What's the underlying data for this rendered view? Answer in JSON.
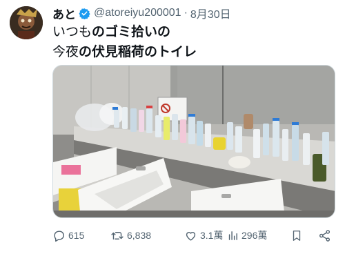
{
  "tweet": {
    "display_name": "あと",
    "handle": "@atoreiyu200001",
    "separator": "·",
    "date": "8月30日",
    "text_line1_light": "いつも",
    "text_line1_bold": "のゴミ拾いの",
    "text_line2_light": "今夜",
    "text_line2_bold": "の伏見稲荷のトイレ"
  },
  "actions": {
    "replies": "615",
    "retweets": "6,838",
    "likes": "3.1萬",
    "views": "296萬"
  },
  "colors": {
    "verified": "#1d9bf0",
    "secondary_text": "#536471"
  },
  "icons": [
    "verified-badge-icon",
    "reply-icon",
    "retweet-icon",
    "like-icon",
    "views-icon",
    "bookmark-icon",
    "share-icon"
  ]
}
